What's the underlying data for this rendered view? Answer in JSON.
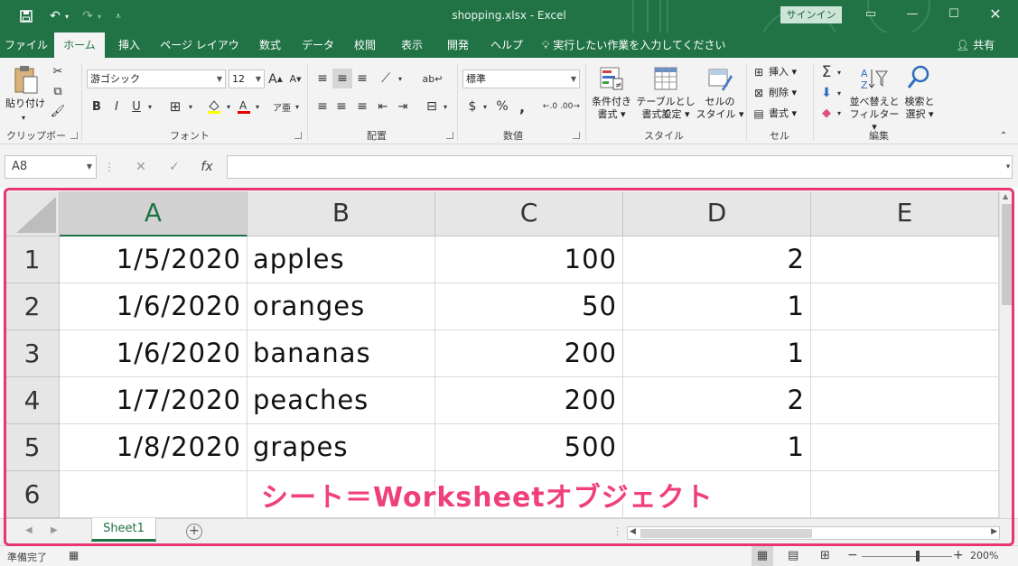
{
  "app": {
    "title": "shopping.xlsx  -  Excel",
    "signin_label": "サインイン",
    "qat": {
      "save_icon": "save-icon",
      "undo_icon": "undo-icon",
      "redo_icon": "redo-icon",
      "customize_icon": "customize-qat-icon"
    }
  },
  "ribbon_tabs": [
    "ファイル",
    "ホーム",
    "挿入",
    "ページ レイアウト",
    "数式",
    "データ",
    "校閲",
    "表示",
    "開発",
    "ヘルプ"
  ],
  "active_tab": "ホーム",
  "tell_me": "実行したい作業を入力してください",
  "share_label": "共有",
  "ribbon": {
    "clipboard": {
      "paste_label": "貼り付け",
      "group_label": "クリップボード"
    },
    "font": {
      "font_name": "游ゴシック",
      "font_size": "12",
      "bold": "B",
      "italic": "I",
      "underline": "U",
      "group_label": "フォント"
    },
    "alignment": {
      "group_label": "配置"
    },
    "number": {
      "format": "標準",
      "currency": "$",
      "percent": "%",
      "comma": ",",
      "group_label": "数値"
    },
    "styles": {
      "conditional_label_1": "条件付き",
      "conditional_label_2": "書式",
      "table_label_1": "テーブルとして",
      "table_label_2": "書式設定",
      "cell_styles_1": "セルの",
      "cell_styles_2": "スタイル",
      "group_label": "スタイル"
    },
    "cells": {
      "insert": "挿入",
      "delete": "削除",
      "format": "書式",
      "group_label": "セル"
    },
    "editing": {
      "sort_1": "並べ替えと",
      "sort_2": "フィルター",
      "find_1": "検索と",
      "find_2": "選択",
      "group_label": "編集"
    }
  },
  "formula_bar": {
    "name_box": "A8",
    "cancel": "✕",
    "enter": "✓",
    "fx": "fx",
    "value": ""
  },
  "sheet": {
    "columns": [
      "A",
      "B",
      "C",
      "D",
      "E"
    ],
    "selected_column": "A",
    "rows": [
      {
        "num": "1",
        "a": "1/5/2020",
        "b": "apples",
        "c": "100",
        "d": "2",
        "e": ""
      },
      {
        "num": "2",
        "a": "1/6/2020",
        "b": "oranges",
        "c": "50",
        "d": "1",
        "e": ""
      },
      {
        "num": "3",
        "a": "1/6/2020",
        "b": "bananas",
        "c": "200",
        "d": "1",
        "e": ""
      },
      {
        "num": "4",
        "a": "1/7/2020",
        "b": "peaches",
        "c": "200",
        "d": "2",
        "e": ""
      },
      {
        "num": "5",
        "a": "1/8/2020",
        "b": "grapes",
        "c": "500",
        "d": "1",
        "e": ""
      },
      {
        "num": "6",
        "a": "",
        "b": "",
        "c": "",
        "d": "",
        "e": ""
      }
    ]
  },
  "sheet_tabs": [
    "Sheet1"
  ],
  "status": {
    "ready": "準備完了",
    "zoom": "200%"
  },
  "annotation": "シート＝Worksheetオブジェクト",
  "colors": {
    "excel_green": "#217346",
    "annotation": "#e8366e"
  }
}
